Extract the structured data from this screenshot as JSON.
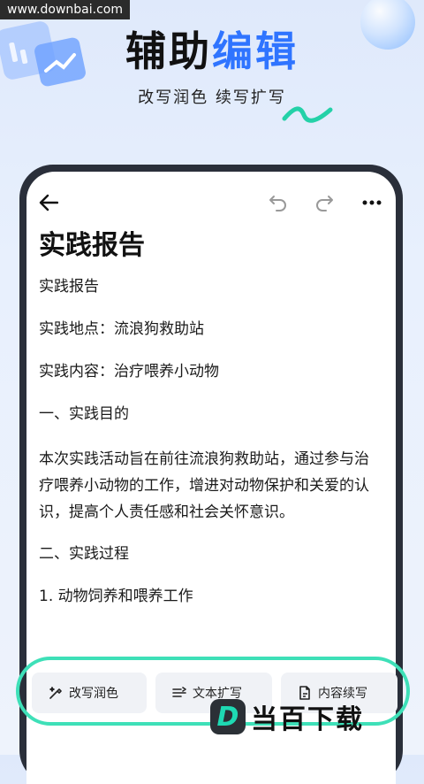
{
  "watermark": {
    "url": "www.downbai.com",
    "brand": "当百下载",
    "logo_letter": "D"
  },
  "hero": {
    "title_dark": "辅助",
    "title_blue": "编辑",
    "subtitle": "改写润色  续写扩写"
  },
  "editor": {
    "doc_title": "实践报告",
    "lines": [
      "实践报告",
      "实践地点：流浪狗救助站",
      "实践内容：治疗喂养小动物",
      "一、实践目的",
      "本次实践活动旨在前往流浪狗救助站，通过参与治疗喂养小动物的工作，增进对动物保护和关爱的认识，提高个人责任感和社会关怀意识。",
      "二、实践过程",
      "1. 动物饲养和喂养工作"
    ]
  },
  "actions": [
    {
      "label": "改写润色",
      "icon": "wand-icon"
    },
    {
      "label": "文本扩写",
      "icon": "expand-icon"
    },
    {
      "label": "内容续写",
      "icon": "document-icon"
    }
  ],
  "colors": {
    "accent_blue": "#2f74ff",
    "accent_green": "#3ee0b8",
    "phone_frame": "#2a2f3a"
  }
}
